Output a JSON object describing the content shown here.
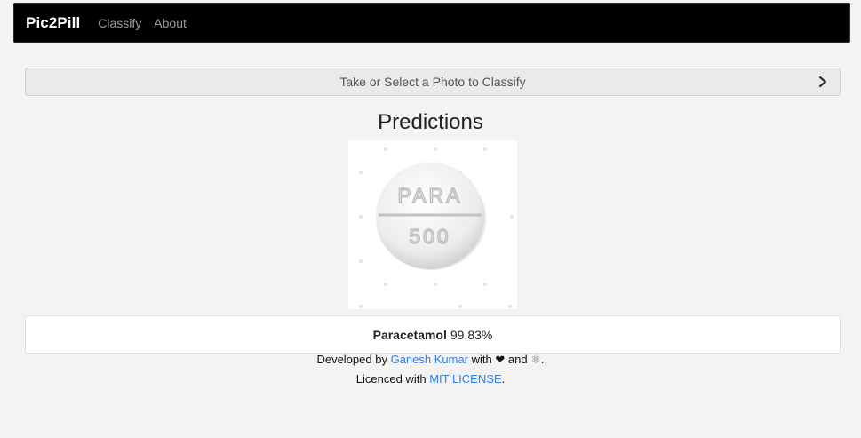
{
  "navbar": {
    "brand": "Pic2Pill",
    "links": [
      "Classify",
      "About"
    ]
  },
  "classify_bar": {
    "label": "Take or Select a Photo to Classify",
    "icon": "chevron-right-icon"
  },
  "predictions": {
    "title": "Predictions",
    "image_text_line1": "PARA",
    "image_text_line2": "500",
    "result_name": "Paracetamol",
    "result_confidence": "99.83%"
  },
  "footer": {
    "developed_prefix": "Developed by",
    "developer_name": "Ganesh Kumar",
    "with_text": "with",
    "heart": "❤",
    "and_text": "and",
    "react_symbol": "⚛",
    "period": ".",
    "licence_prefix": "Licenced with",
    "license_name": "MIT LICENSE"
  },
  "colors": {
    "navbar_bg": "#000000",
    "page_bg": "#f4f3f1",
    "link": "#2f80ed"
  }
}
